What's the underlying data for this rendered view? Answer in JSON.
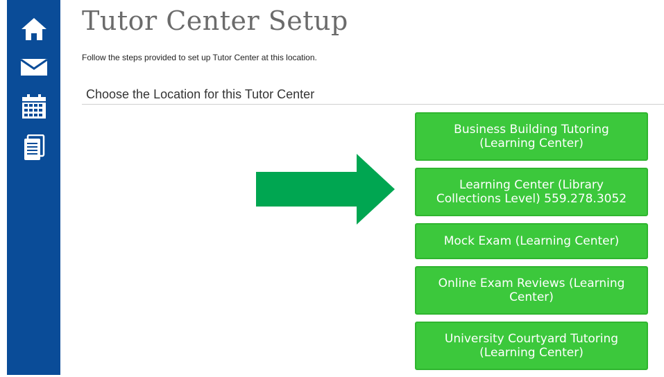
{
  "sidebar": {
    "items": [
      {
        "icon": "home-icon"
      },
      {
        "icon": "mail-icon"
      },
      {
        "icon": "calendar-icon"
      },
      {
        "icon": "documents-icon"
      }
    ],
    "color": "#0a4c98"
  },
  "page": {
    "title": "Tutor Center Setup",
    "subtitle": "Follow the steps provided to set up Tutor Center at this location.",
    "section_heading": "Choose the Location for this Tutor Center"
  },
  "locations": [
    {
      "label": "Business Building Tutoring (Learning Center)"
    },
    {
      "label": "Learning Center (Library Collections Level) 559.278.3052"
    },
    {
      "label": "Mock Exam (Learning Center)"
    },
    {
      "label": "Online Exam Reviews (Learning Center)"
    },
    {
      "label": "University Courtyard Tutoring (Learning Center)"
    }
  ],
  "colors": {
    "button": "#3cc83c",
    "arrow": "#00a651"
  }
}
